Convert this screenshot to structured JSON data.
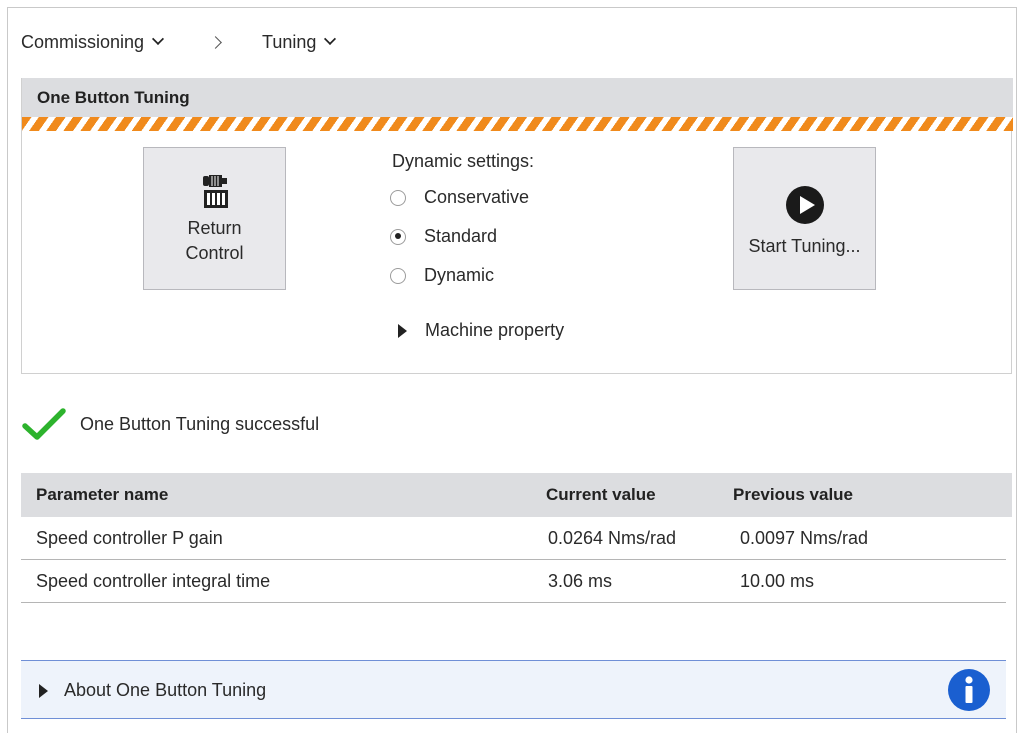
{
  "breadcrumb": {
    "items": [
      {
        "label": "Commissioning",
        "icon": "chevron-down-icon"
      },
      {
        "label": "Tuning",
        "icon": "chevron-down-icon"
      }
    ],
    "separator_icon": "chevron-right-icon"
  },
  "tuning_panel": {
    "title": "One Button Tuning",
    "hazard_colors": [
      "#f08a1c",
      "#ffffff"
    ],
    "return_button": {
      "icon": "motor-control-icon",
      "label_line1": "Return",
      "label_line2": "Control"
    },
    "dynamic_settings": {
      "label": "Dynamic settings:",
      "options": [
        {
          "label": "Conservative",
          "selected": false
        },
        {
          "label": "Standard",
          "selected": true
        },
        {
          "label": "Dynamic",
          "selected": false
        }
      ]
    },
    "machine_property": {
      "label": "Machine property",
      "icon": "expand-triangle-icon"
    },
    "start_button": {
      "icon": "play-icon",
      "label": "Start Tuning..."
    }
  },
  "status": {
    "icon": "checkmark-icon",
    "color": "#2db32d",
    "message": "One Button Tuning successful"
  },
  "results_table": {
    "columns": [
      "Parameter name",
      "Current value",
      "Previous value"
    ],
    "rows": [
      [
        "Speed controller P gain",
        "0.0264 Nms/rad",
        "0.0097 Nms/rad"
      ],
      [
        "Speed controller integral time",
        "3.06 ms",
        "10.00 ms"
      ]
    ]
  },
  "about": {
    "label": "About One Button Tuning",
    "icon": "info-icon",
    "icon_color": "#1a5fd0"
  }
}
